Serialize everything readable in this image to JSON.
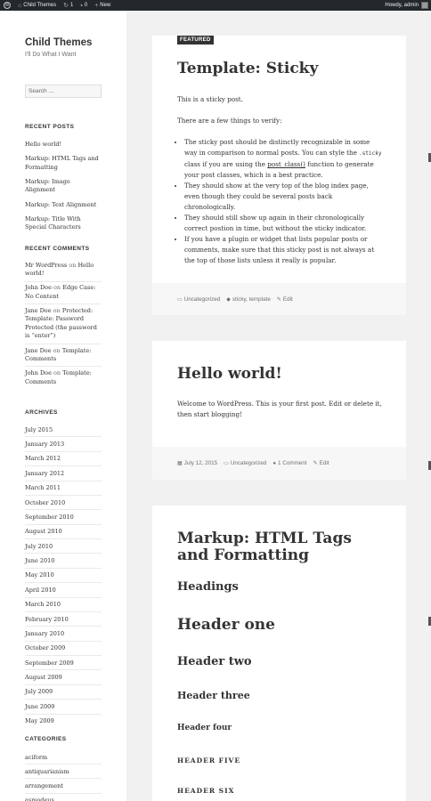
{
  "adminbar": {
    "site_name": "Child Themes",
    "updates_count": "1",
    "comments_count": "0",
    "new_label": "New",
    "howdy": "Howdy, admin"
  },
  "site": {
    "title": "Child Themes",
    "description": "I'll Do What I Want"
  },
  "search": {
    "placeholder": "Search …"
  },
  "recent_posts": {
    "title": "RECENT POSTS",
    "items": [
      "Hello world!",
      "Markup: HTML Tags and Formatting",
      "Markup: Image Alignment",
      "Markup: Text Alignment",
      "Markup: Title With Special Characters"
    ]
  },
  "recent_comments": {
    "title": "RECENT COMMENTS",
    "items": [
      {
        "author": "Mr WordPress",
        "on": "on",
        "post": "Hello world!"
      },
      {
        "author": "John Doe",
        "on": "on",
        "post": "Edge Case: No Content"
      },
      {
        "author": "Jane Doe",
        "on": "on",
        "post": "Protected: Template: Password Protected (the password is “enter”)"
      },
      {
        "author": "Jane Doe",
        "on": "on",
        "post": "Template: Comments"
      },
      {
        "author": "John Doe",
        "on": "on",
        "post": "Template: Comments"
      }
    ]
  },
  "archives": {
    "title": "ARCHIVES",
    "items": [
      "July 2015",
      "January 2013",
      "March 2012",
      "January 2012",
      "March 2011",
      "October 2010",
      "September 2010",
      "August 2010",
      "July 2010",
      "June 2010",
      "May 2010",
      "April 2010",
      "March 2010",
      "February 2010",
      "January 2010",
      "October 2009",
      "September 2009",
      "August 2009",
      "July 2009",
      "June 2009",
      "May 2009"
    ]
  },
  "categories": {
    "title": "CATEGORIES",
    "items": [
      "aciform",
      "antiquarianism",
      "arrangement",
      "asmodeus"
    ]
  },
  "post1": {
    "featured": "FEATURED",
    "title": "Template: Sticky",
    "p1": "This is a sticky post.",
    "p2": "There are a few things to verify:",
    "li1a": "The sticky post should be distinctly recognizable in some way in comparison to normal posts. You can style the ",
    "li1code": ".sticky",
    "li1b": " class if you are using the ",
    "li1link": "post_class()",
    "li1c": " function to generate your post classes, which is a best practice.",
    "li2": "They should show at the very top of the blog index page, even though they could be several posts back chronologically.",
    "li3": "They should still show up again in their chronologically correct postion in time, but without the sticky indicator.",
    "li4": "If you have a plugin or widget that lists popular posts or comments, make sure that this sticky post is not always at the top of those lists unless it really is popular.",
    "category": "Uncategorized",
    "tags": "sticky, template",
    "edit": "Edit"
  },
  "post2": {
    "title": "Hello world!",
    "body": "Welcome to WordPress. This is your first post. Edit or delete it, then start blogging!",
    "date": "July 12, 2015",
    "category": "Uncategorized",
    "comments": "1 Comment",
    "edit": "Edit"
  },
  "post3": {
    "title": "Markup: HTML Tags and Formatting",
    "headings": "Headings",
    "h1": "Header one",
    "h2": "Header two",
    "h3": "Header three",
    "h4": "Header four",
    "h5": "HEADER FIVE",
    "h6": "HEADER SIX"
  },
  "colors": {
    "adminbar": "#23282d",
    "background": "#f1f1f1",
    "text": "#333333",
    "muted": "#707070"
  }
}
